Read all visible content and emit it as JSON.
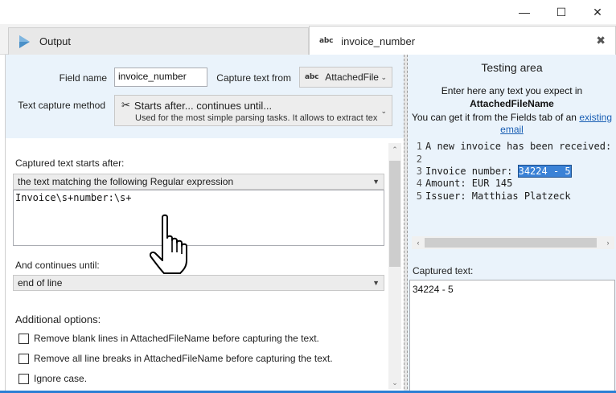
{
  "window_controls": {
    "minimize": "—",
    "maximize": "☐",
    "close": "✕"
  },
  "tabs": [
    {
      "label": "Output",
      "icon": "play-triangle-icon",
      "active": false
    },
    {
      "label": "invoice_number",
      "icon": "abc-text-icon",
      "icon_text": "abc",
      "active": true,
      "close": "✖"
    }
  ],
  "config": {
    "field_name_label": "Field name",
    "field_name_value": "invoice_number",
    "capture_from_label": "Capture text from",
    "capture_from_icon_text": "abc",
    "capture_from_value": "AttachedFile",
    "method_label": "Text capture method",
    "method_icon": "scissors-icon",
    "method_title": "Starts after... continues until...",
    "method_desc": "Used for the most simple parsing tasks. It allows to extract tex"
  },
  "starts_after": {
    "label": "Captured text starts after:",
    "mode": "the text matching the following Regular expression",
    "regex": "Invoice\\s+number:\\s+"
  },
  "continues_until": {
    "label": "And continues until:",
    "mode": "end of line"
  },
  "additional": {
    "label": "Additional options:",
    "options": [
      {
        "label": "Remove blank lines in AttachedFileName before capturing the text.",
        "checked": false
      },
      {
        "label": "Remove all line breaks in AttachedFileName before capturing the text.",
        "checked": false
      },
      {
        "label": "Ignore case.",
        "checked": false
      }
    ]
  },
  "testing": {
    "title": "Testing area",
    "intro_line1": "Enter here any text you expect in",
    "intro_field": "AttachedFileName",
    "intro_line3": "You can get it from the Fields tab of an",
    "link_part1": "existing",
    "link_part2": "email",
    "lines": [
      {
        "n": "1",
        "text": "A new invoice has been received:"
      },
      {
        "n": "2",
        "text": ""
      },
      {
        "n": "3",
        "prefix": "Invoice number: ",
        "selected": "34224 - 5"
      },
      {
        "n": "4",
        "text": "Amount: EUR 145"
      },
      {
        "n": "5",
        "text": "Issuer: Matthias Platzeck"
      }
    ],
    "captured_label": "Captured text:",
    "captured_value": "34224 - 5"
  },
  "colors": {
    "accent": "#2b7fd4",
    "selection": "#3b82d6",
    "panel_bg": "#eaf3fb",
    "play_icon": "#4a90c8"
  }
}
